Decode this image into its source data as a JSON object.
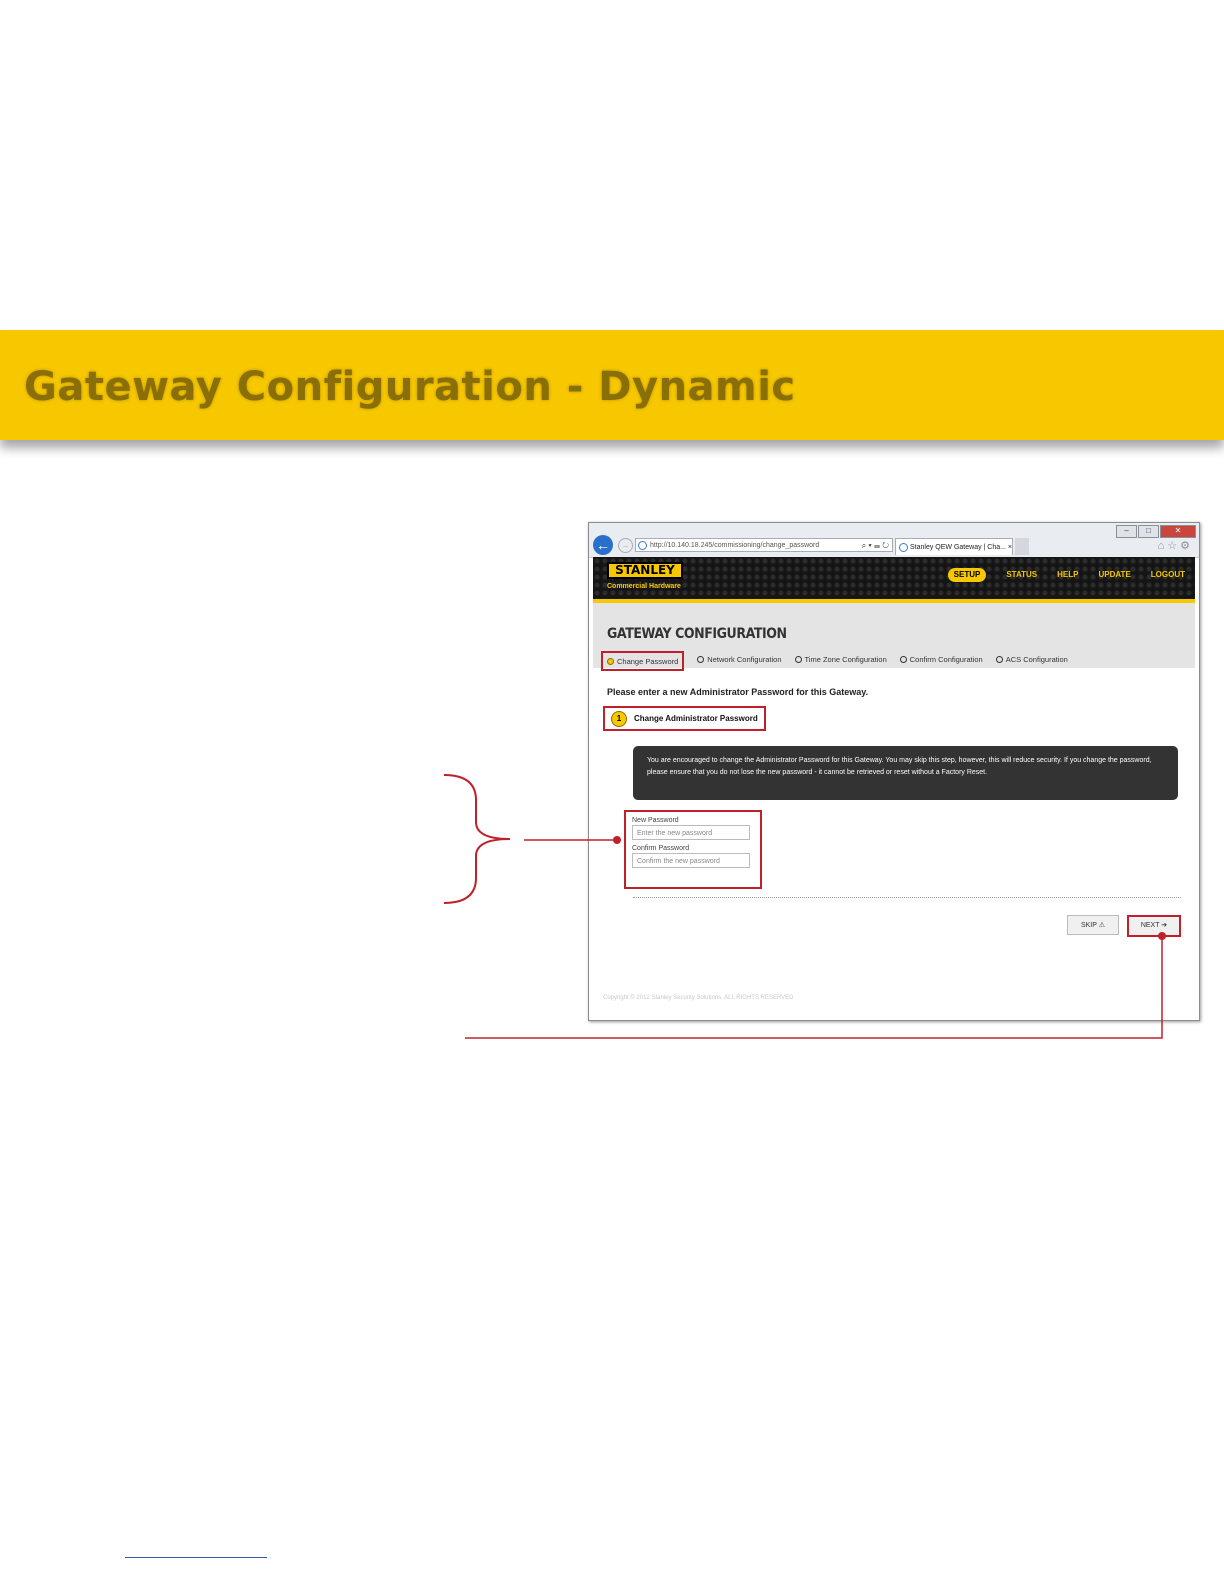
{
  "slide": {
    "title": "Gateway Configuration - Dynamic"
  },
  "browser": {
    "url": "http://10.140.18.245/commissioning/change_password",
    "address_tools": "⌕ ▾ ☰ ↻",
    "tab_title": "Stanley QEW Gateway | Cha... ×",
    "window_controls": [
      "–",
      "□",
      "✕"
    ]
  },
  "site": {
    "logo": "STANLEY",
    "logo_sub": "Commercial Hardware",
    "nav": [
      "SETUP",
      "STATUS",
      "HELP",
      "UPDATE",
      "LOGOUT"
    ],
    "active_nav": "SETUP"
  },
  "page": {
    "title": "GATEWAY CONFIGURATION",
    "steps": [
      "Change Password",
      "Network Configuration",
      "Time Zone Configuration",
      "Confirm Configuration",
      "ACS Configuration"
    ],
    "instruction": "Please enter a new Administrator Password for this Gateway.",
    "section_number": "1",
    "section_label": "Change Administrator Password",
    "notice": "You are encouraged to change the Administrator Password for this Gateway. You may skip this step, however, this will reduce security. If you change the password, please ensure that you do not lose the new password - it cannot be retrieved or reset without a Factory Reset.",
    "new_password_label": "New Password",
    "new_password_placeholder": "Enter the new password",
    "confirm_password_label": "Confirm Password",
    "confirm_password_placeholder": "Confirm the new password",
    "skip_label": "SKIP ⚠",
    "next_label": "NEXT ➔",
    "copyright": "Copyright © 2012 Stanley Security Solutions. ALL RIGHTS RESERVED"
  },
  "colors": {
    "brand_yellow": "#f7c800",
    "annotation_red": "#c0202a",
    "header_dark": "#151515"
  }
}
